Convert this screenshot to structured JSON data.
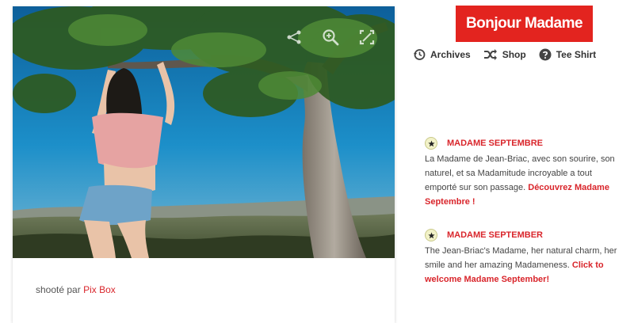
{
  "site": {
    "brand": "Bonjour Madame"
  },
  "nav": {
    "items": [
      {
        "label": "Archives",
        "icon": "history-icon"
      },
      {
        "label": "Shop",
        "icon": "shuffle-icon"
      },
      {
        "label": "Tee Shirt",
        "icon": "question-icon"
      }
    ]
  },
  "post": {
    "caption_prefix": "shooté par",
    "photographer": "Pix Box",
    "tools": [
      "share-icon",
      "zoom-icon",
      "expand-icon"
    ]
  },
  "news": [
    {
      "title": "MADAME SEPTEMBRE",
      "body": "La Madame de Jean-Briac, avec son sourire, son naturel, et sa Madamitude incroyable a tout emporté sur son passage.",
      "link": "Découvrez Madame Septembre !"
    },
    {
      "title": "MADAME SEPTEMBER",
      "body": "The Jean-Briac's Madame, her natural charm, her smile and her amazing Madameness.",
      "link": "Click to welcome Madame September!"
    }
  ],
  "colors": {
    "accent": "#e3241f",
    "link": "#d9252b"
  }
}
